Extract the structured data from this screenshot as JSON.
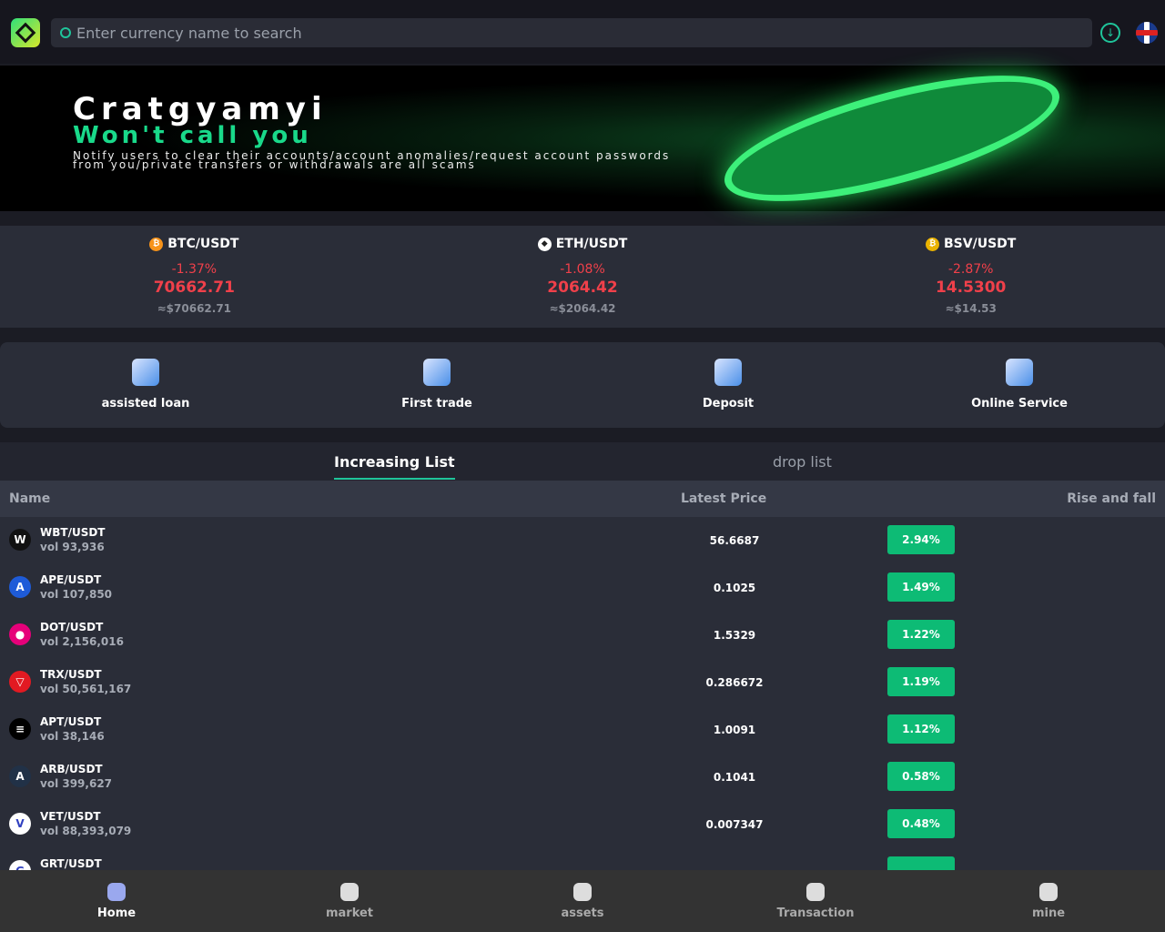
{
  "header": {
    "search_placeholder": "Enter currency name to search"
  },
  "banner": {
    "title": "Cratgyamyi",
    "subtitle": "Won't call you",
    "text": "Notify users to clear their accounts/account anomalies/request account passwords from you/private transfers or withdrawals are all scams"
  },
  "tickers": [
    {
      "pair": "BTC/USDT",
      "icon": "₿",
      "change": "-1.37%",
      "price": "70662.71",
      "usd": "≈$70662.71"
    },
    {
      "pair": "ETH/USDT",
      "icon": "◆",
      "change": "-1.08%",
      "price": "2064.42",
      "usd": "≈$2064.42"
    },
    {
      "pair": "BSV/USDT",
      "icon": "₿",
      "change": "-2.87%",
      "price": "14.5300",
      "usd": "≈$14.53"
    }
  ],
  "shortcuts": [
    "assisted loan",
    "First trade",
    "Deposit",
    "Online Service"
  ],
  "tabs": {
    "increasing": "Increasing List",
    "drop": "drop list"
  },
  "table": {
    "headers": {
      "name": "Name",
      "price": "Latest Price",
      "change": "Rise and fall"
    },
    "rows": [
      {
        "pair": "WBT/USDT",
        "vol": "vol 93,936",
        "price": "56.6687",
        "change": "2.94%",
        "icon": "W",
        "color": "#111"
      },
      {
        "pair": "APE/USDT",
        "vol": "vol 107,850",
        "price": "0.1025",
        "change": "1.49%",
        "icon": "A",
        "color": "#1e5bd8"
      },
      {
        "pair": "DOT/USDT",
        "vol": "vol 2,156,016",
        "price": "1.5329",
        "change": "1.22%",
        "icon": "●",
        "color": "#e6007a"
      },
      {
        "pair": "TRX/USDT",
        "vol": "vol 50,561,167",
        "price": "0.286672",
        "change": "1.19%",
        "icon": "▽",
        "color": "#e21a22"
      },
      {
        "pair": "APT/USDT",
        "vol": "vol 38,146",
        "price": "1.0091",
        "change": "1.12%",
        "icon": "≡",
        "color": "#000"
      },
      {
        "pair": "ARB/USDT",
        "vol": "vol 399,627",
        "price": "0.1041",
        "change": "0.58%",
        "icon": "A",
        "color": "#213147"
      },
      {
        "pair": "VET/USDT",
        "vol": "vol 88,393,079",
        "price": "0.007347",
        "change": "0.48%",
        "icon": "V",
        "color": "#fff"
      },
      {
        "pair": "GRT/USDT",
        "vol": "",
        "price": "",
        "change": "",
        "icon": "G",
        "color": "#fff"
      }
    ]
  },
  "nav": [
    "Home",
    "market",
    "assets",
    "Transaction",
    "mine"
  ]
}
